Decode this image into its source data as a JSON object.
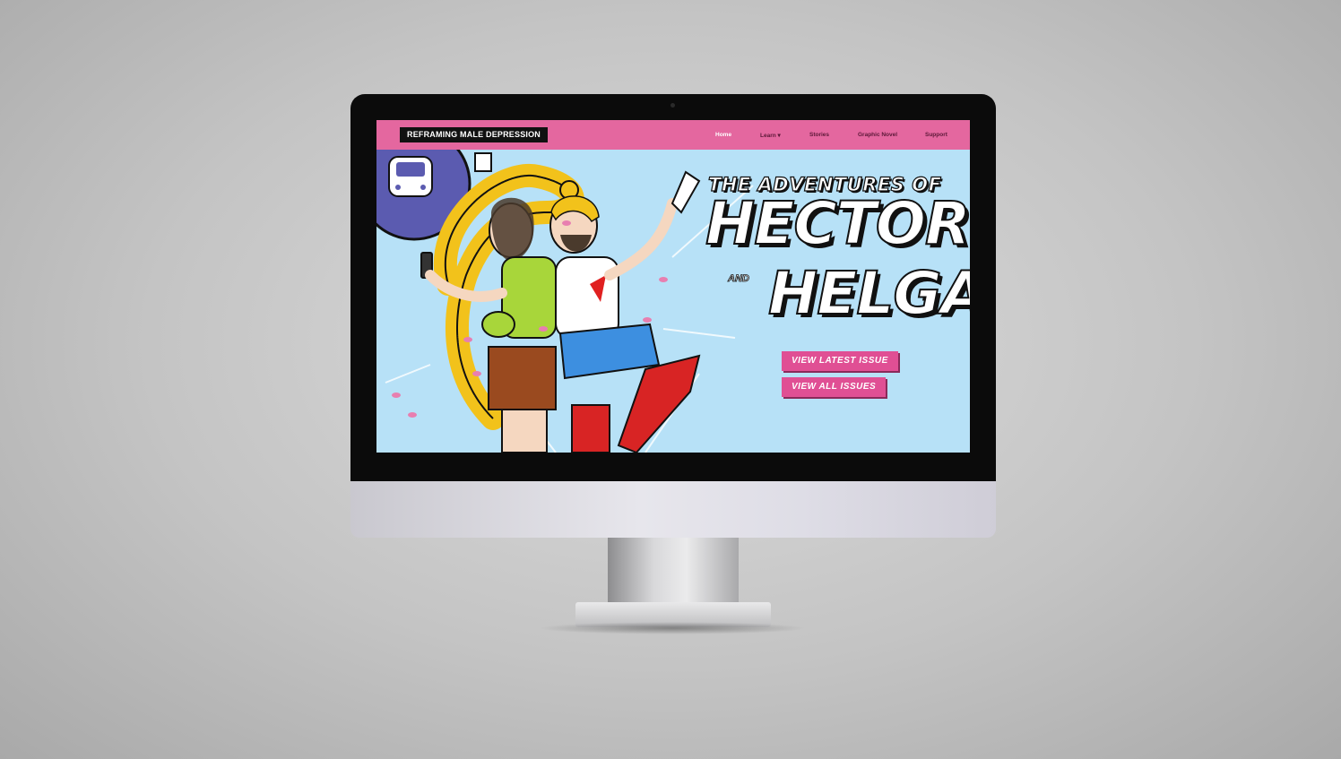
{
  "nav": {
    "brand": "REFRAMING MALE DEPRESSION",
    "items": [
      {
        "label": "Home"
      },
      {
        "label": "Learn ▾"
      },
      {
        "label": "Stories"
      },
      {
        "label": "Graphic Novel"
      },
      {
        "label": "Support"
      }
    ]
  },
  "hero": {
    "title_small": "THE ADVENTURES OF",
    "title_main_1": "HECTOR",
    "title_and": "AND",
    "title_main_2": "HELGA",
    "buttons": [
      {
        "label": "VIEW LATEST ISSUE"
      },
      {
        "label": "VIEW ALL ISSUES"
      }
    ]
  },
  "colors": {
    "nav_bg": "#e4679f",
    "hero_bg": "#b7e1f7",
    "button_bg": "#e04f94",
    "sign_circle": "#5b5bb0"
  },
  "icons": [
    "bus-sign-icon"
  ]
}
